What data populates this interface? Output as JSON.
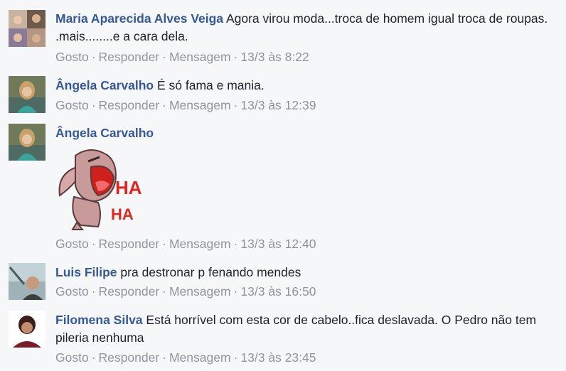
{
  "actions": {
    "like": "Gosto",
    "reply": "Responder",
    "message": "Mensagem",
    "separator": "·"
  },
  "comments": [
    {
      "author": "Maria Aparecida Alves Veiga",
      "text": "Agora virou moda...troca de homem igual troca de roupas. .mais........e a cara dela.",
      "time": "13/3 às 8:22"
    },
    {
      "author": "Ângela Carvalho",
      "text": "É só fama e mania.",
      "time": "13/3 às 12:39"
    },
    {
      "author": "Ângela Carvalho",
      "text": "",
      "sticker": "laughing-dog-sticker",
      "sticker_text": [
        "HA",
        "HA"
      ],
      "time": "13/3 às 12:40"
    },
    {
      "author": "Luis Filipe",
      "text": "pra destronar p fenando mendes",
      "time": "13/3 às 16:50"
    },
    {
      "author": "Filomena Silva",
      "text": "Está horrível com esta cor de cabelo..fica deslavada. O Pedro não tem pileria nenhuma",
      "time": "13/3 às 23:45"
    }
  ],
  "colors": {
    "author": "#365899",
    "meta": "#90949c",
    "background": "#f6f7f9",
    "sticker_red": "#e0261f"
  }
}
